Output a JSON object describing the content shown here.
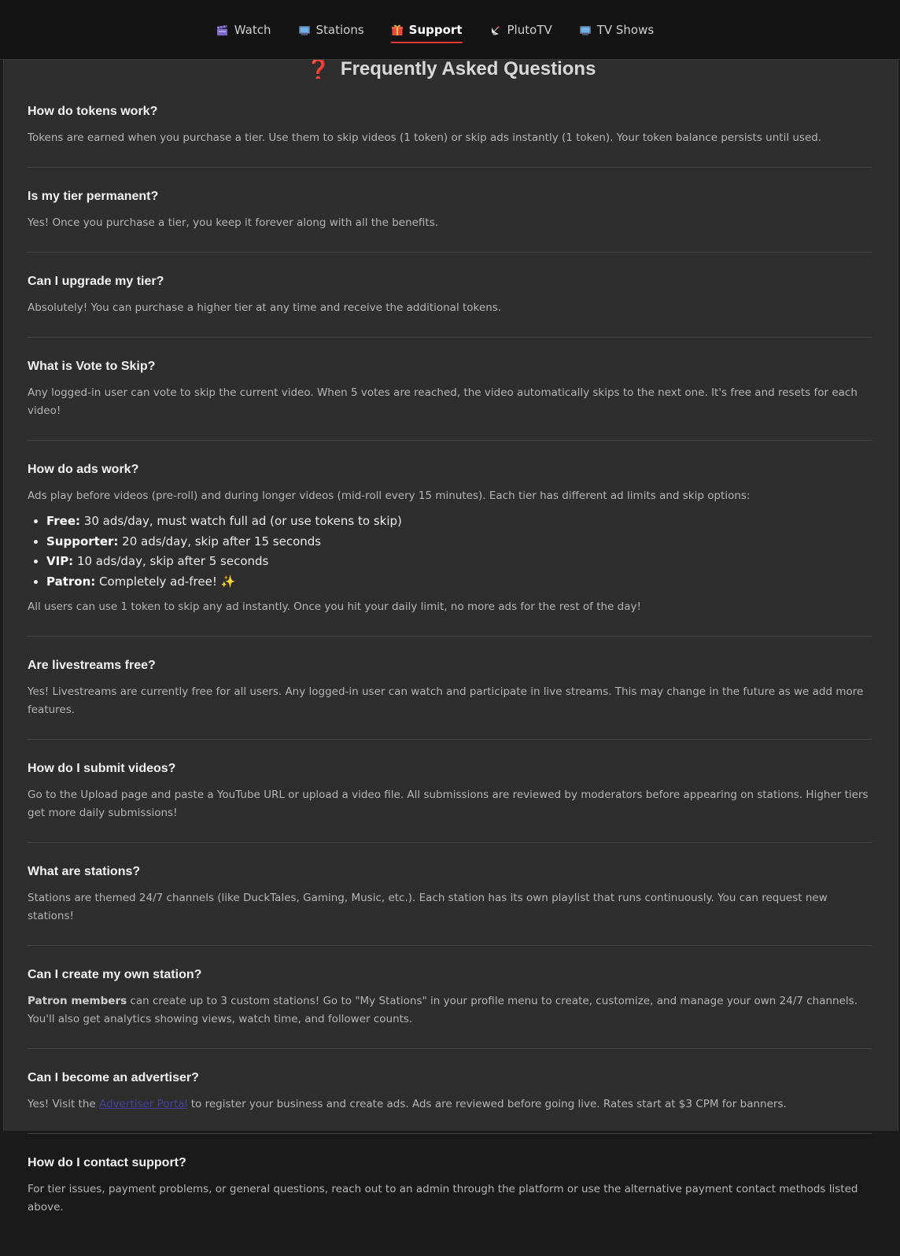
{
  "nav": {
    "items": [
      {
        "label": "Watch",
        "icon": "clapperboard-icon",
        "active": false
      },
      {
        "label": "Stations",
        "icon": "tv-icon",
        "active": false
      },
      {
        "label": "Support",
        "icon": "gift-icon",
        "active": true
      },
      {
        "label": "PlutoTV",
        "icon": "satellite-dish-icon",
        "active": false
      },
      {
        "label": "TV Shows",
        "icon": "tv-icon",
        "active": false
      }
    ]
  },
  "faq": {
    "title_icon": "❓",
    "title": "Frequently Asked Questions",
    "items": [
      {
        "q": "How do tokens work?",
        "a": "Tokens are earned when you purchase a tier. Use them to skip videos (1 token) or skip ads instantly (1 token). Your token balance persists until used."
      },
      {
        "q": "Is my tier permanent?",
        "a": "Yes! Once you purchase a tier, you keep it forever along with all the benefits."
      },
      {
        "q": "Can I upgrade my tier?",
        "a": "Absolutely! You can purchase a higher tier at any time and receive the additional tokens."
      },
      {
        "q": "What is Vote to Skip?",
        "a": "Any logged-in user can vote to skip the current video. When 5 votes are reached, the video automatically skips to the next one. It's free and resets for each video!"
      },
      {
        "q": "How do ads work?",
        "a": "Ads play before videos (pre-roll) and during longer videos (mid-roll every 15 minutes). Each tier has different ad limits and skip options:",
        "tiers": [
          {
            "name": "Free:",
            "desc": " 30 ads/day, must watch full ad (or use tokens to skip)"
          },
          {
            "name": "Supporter:",
            "desc": " 20 ads/day, skip after 15 seconds"
          },
          {
            "name": "VIP:",
            "desc": " 10 ads/day, skip after 5 seconds"
          },
          {
            "name": "Patron:",
            "desc": " Completely ad-free! ",
            "sparkle": "✨"
          }
        ],
        "note": "All users can use 1 token to skip any ad instantly. Once you hit your daily limit, no more ads for the rest of the day!"
      },
      {
        "q": "Are livestreams free?",
        "a": "Yes! Livestreams are currently free for all users. Any logged-in user can watch and participate in live streams. This may change in the future as we add more features."
      },
      {
        "q": "How do I submit videos?",
        "a": "Go to the Upload page and paste a YouTube URL or upload a video file. All submissions are reviewed by moderators before appearing on stations. Higher tiers get more daily submissions!"
      },
      {
        "q": "What are stations?",
        "a": "Stations are themed 24/7 channels (like DuckTales, Gaming, Music, etc.). Each station has its own playlist that runs continuously. You can request new stations!"
      },
      {
        "q": "Can I create my own station?",
        "a_bold": "Patron members",
        "a": " can create up to 3 custom stations! Go to \"My Stations\" in your profile menu to create, customize, and manage your own 24/7 channels. You'll also get analytics showing views, watch time, and follower counts."
      },
      {
        "q": "Can I become an advertiser?",
        "a_pre": "Yes! Visit the ",
        "a_link": "Advertiser Portal",
        "a_post": " to register your business and create ads. Ads are reviewed before going live. Rates start at $3 CPM for banners."
      },
      {
        "q": "How do I contact support?",
        "a": "For tier issues, payment problems, or general questions, reach out to an admin through the platform or use the alternative payment contact methods listed above."
      }
    ]
  }
}
